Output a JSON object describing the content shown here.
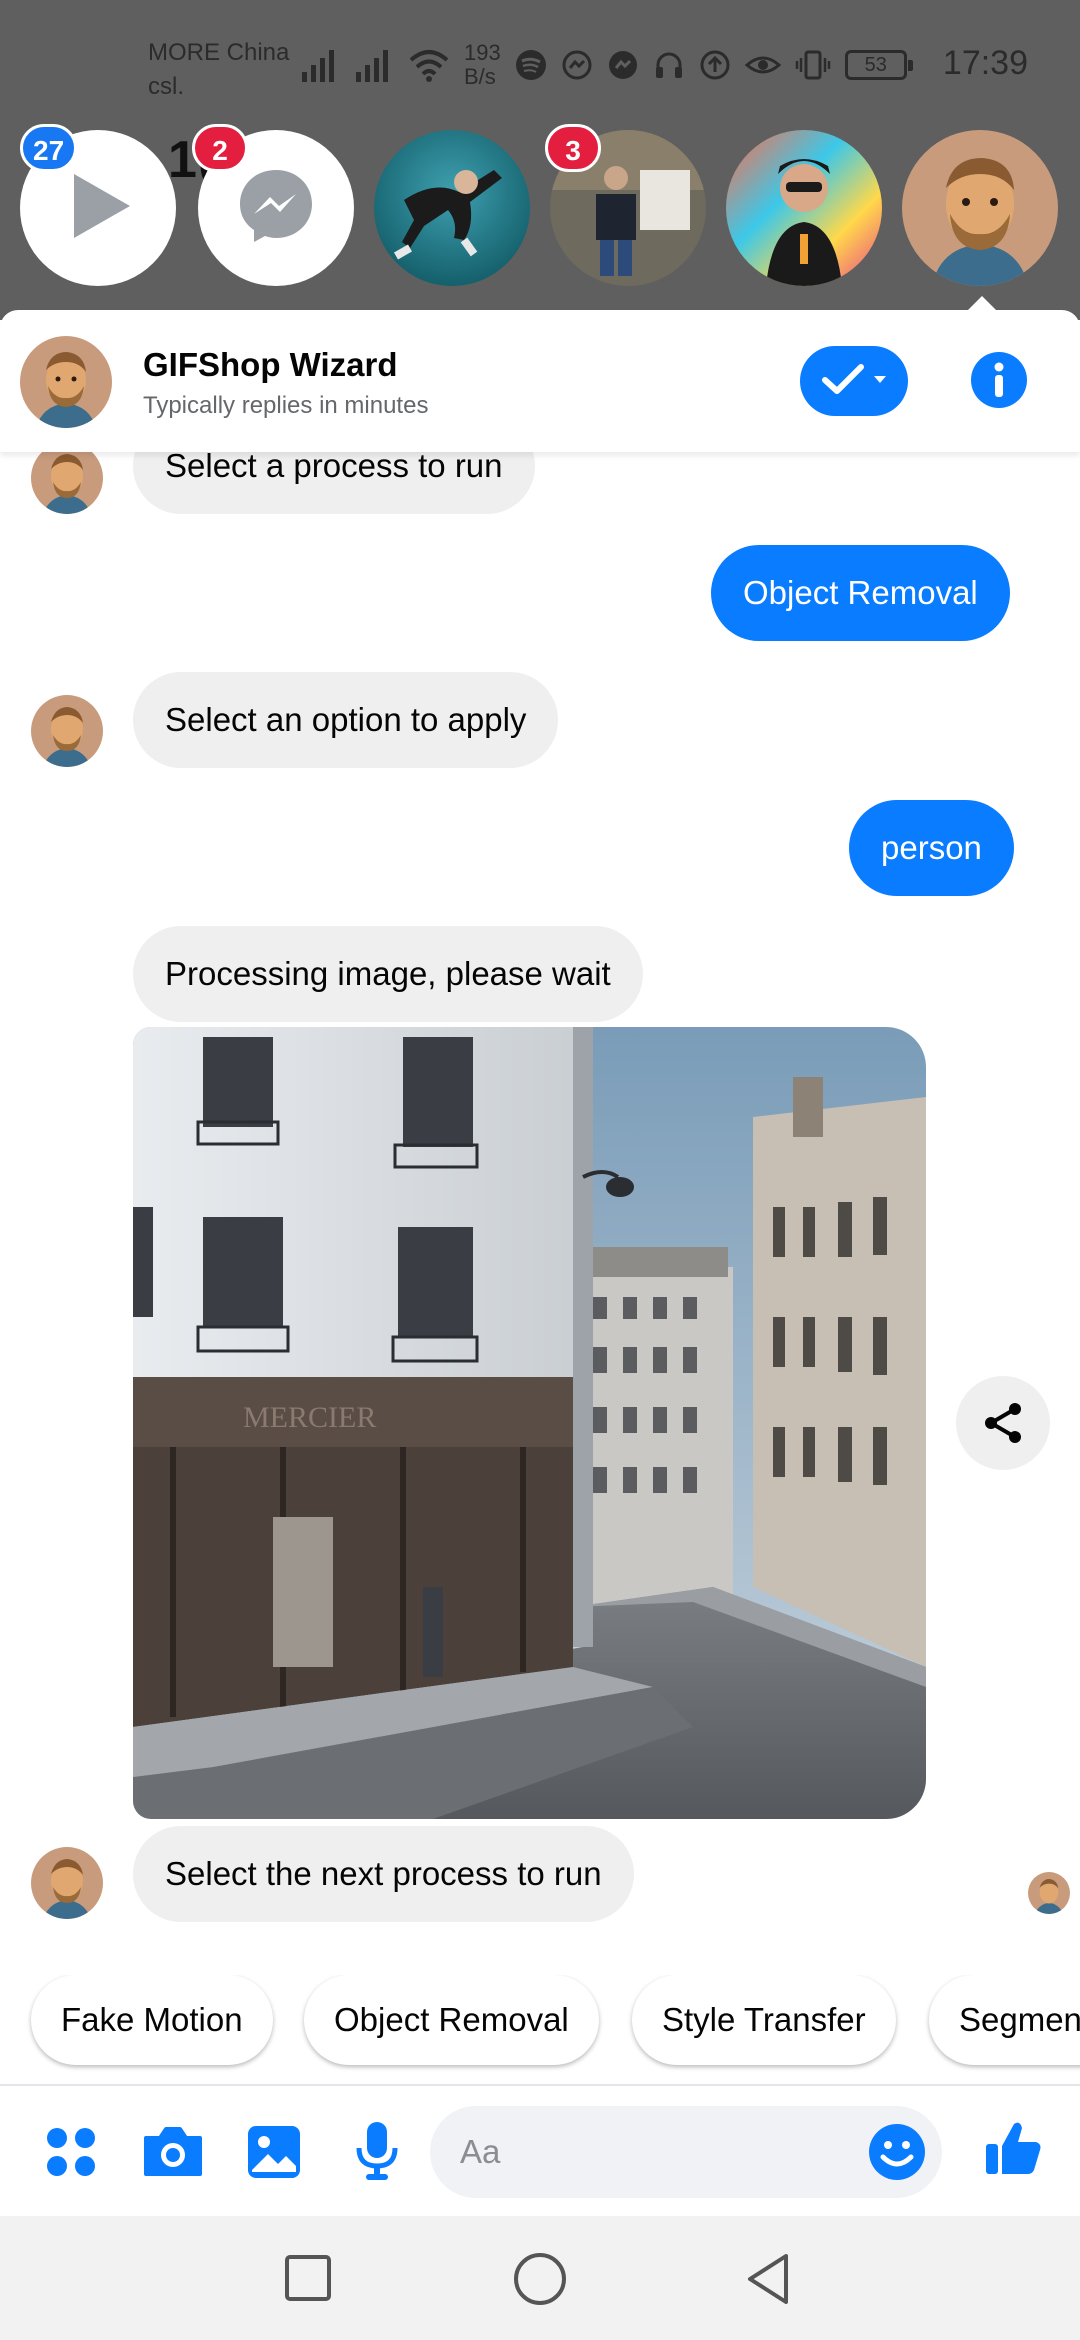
{
  "status_bar": {
    "carrier_line1": "MORE China",
    "carrier_line2": "csl.",
    "net_speed_value": "193",
    "net_speed_unit": "B/s",
    "battery": "53",
    "time": "17:39"
  },
  "background": {
    "partial_text": "1( 2"
  },
  "chat_heads": [
    {
      "name": "video-player-head",
      "badge": "27",
      "badge_color": "#1877f2"
    },
    {
      "name": "messenger-head",
      "badge": "2",
      "badge_color": "#e41e3f"
    },
    {
      "name": "contact-head-1",
      "badge": ""
    },
    {
      "name": "contact-head-2",
      "badge": "3",
      "badge_color": "#e41e3f"
    },
    {
      "name": "contact-head-3",
      "badge": ""
    },
    {
      "name": "contact-head-active",
      "badge": ""
    }
  ],
  "header": {
    "title": "GIFShop Wizard",
    "subtitle": "Typically replies in minutes"
  },
  "messages": {
    "m1": "Select a process to run",
    "m2": "Object Removal",
    "m3": "Select an option to apply",
    "m4": "person",
    "m5": "Processing image, please wait",
    "photo_sign": "MERCIER",
    "m6": "Select the next process to run"
  },
  "quick_replies": [
    "Fake Motion",
    "Object Removal",
    "Style Transfer",
    "Segmen"
  ],
  "composer": {
    "placeholder": "Aa"
  },
  "colors": {
    "messenger_blue": "#0a7cff",
    "incoming_bubble": "#efefef",
    "badge_red": "#e41e3f",
    "badge_blue": "#1877f2"
  }
}
